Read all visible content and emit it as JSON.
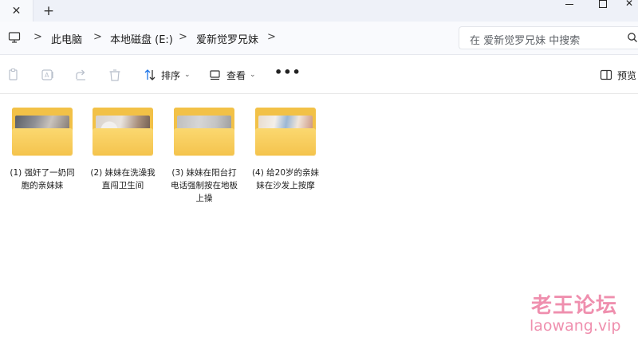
{
  "titlebar": {
    "tab_close": "✕",
    "new_tab": "+",
    "window_close": "✕"
  },
  "address": {
    "crumbs": [
      "此电脑",
      "本地磁盘 (E:)",
      "爱新觉罗兄妹"
    ],
    "separator": ">",
    "search_placeholder": "在 爱新觉罗兄妹 中搜索"
  },
  "toolbar": {
    "sort_label": "排序",
    "view_label": "查看",
    "more": "•••",
    "preview_label": "预览"
  },
  "folders": [
    {
      "name": "(1) 强奸了一奶同胞的亲妹妹"
    },
    {
      "name": "(2) 妹妹在洗澡我直闯卫生间"
    },
    {
      "name": "(3) 妹妹在阳台打电话强制按在地板上操"
    },
    {
      "name": "(4) 给20岁的亲妹妹在沙发上按摩"
    }
  ],
  "watermark": {
    "text": "老王论坛",
    "url": "laowang.vip"
  },
  "colors": {
    "folder": "#f2c147",
    "watermark": "#ef8fae",
    "accent": "#1a73e8"
  }
}
